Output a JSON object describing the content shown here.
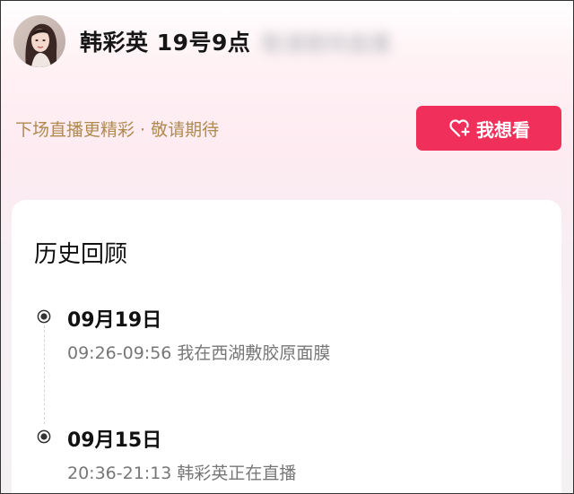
{
  "header": {
    "title": "韩彩英 19号9点",
    "blurred_text": "敬请期待直播",
    "subtitle": "下场直播更精彩 · 敬请期待",
    "want_button_label": "我想看"
  },
  "history": {
    "title": "历史回顾",
    "items": [
      {
        "date": "09月19日",
        "description": "09:26-09:56 我在西湖敷胶原面膜"
      },
      {
        "date": "09月15日",
        "description": "20:36-21:13 韩彩英正在直播"
      }
    ]
  },
  "colors": {
    "accent": "#f0305a",
    "subtitle": "#b08a50"
  },
  "icons": {
    "avatar": "streamer-avatar",
    "want_button": "heart-plus-icon",
    "timeline": "radio-dot-icon"
  }
}
